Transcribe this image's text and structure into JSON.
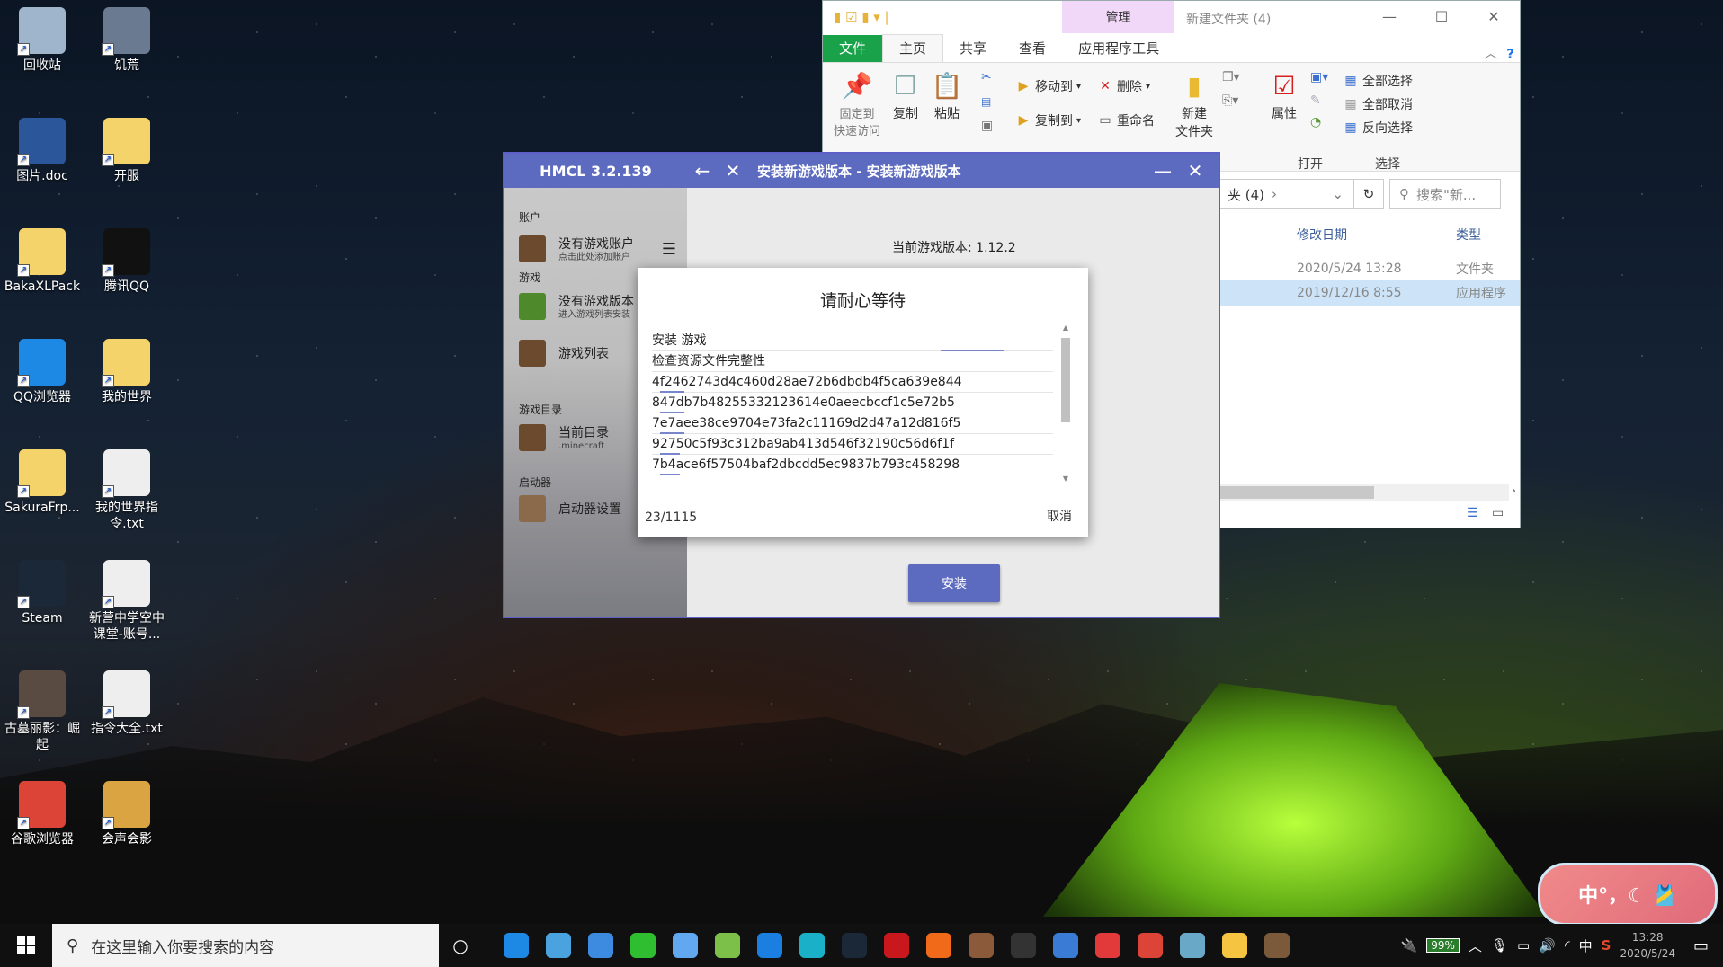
{
  "desktop": {
    "icons": [
      {
        "label": "回收站",
        "name": "recycle-bin",
        "color": "#9fb5cc"
      },
      {
        "label": "饥荒",
        "name": "dont-starve",
        "color": "#6a7a90"
      },
      {
        "label": "图片.doc",
        "name": "word-doc",
        "color": "#2b579a"
      },
      {
        "label": "开服",
        "name": "folder",
        "color": "#f5d36b"
      },
      {
        "label": "BakaXLPack",
        "name": "folder",
        "color": "#f5d36b"
      },
      {
        "label": "腾讯QQ",
        "name": "qq",
        "color": "#111111"
      },
      {
        "label": "QQ浏览器",
        "name": "qq-browser",
        "color": "#1e88e5"
      },
      {
        "label": "我的世界",
        "name": "folder",
        "color": "#f5d36b"
      },
      {
        "label": "SakuraFrp...",
        "name": "folder",
        "color": "#f5d36b"
      },
      {
        "label": "我的世界指令.txt",
        "name": "text-file",
        "color": "#eeeeee"
      },
      {
        "label": "Steam",
        "name": "steam",
        "color": "#1b2838"
      },
      {
        "label": "新营中学空中课堂-账号...",
        "name": "text-file",
        "color": "#eeeeee"
      },
      {
        "label": "古墓丽影：崛起",
        "name": "tomb-raider",
        "color": "#5a4b42"
      },
      {
        "label": "指令大全.txt",
        "name": "text-file",
        "color": "#eeeeee"
      },
      {
        "label": "谷歌浏览器",
        "name": "chrome",
        "color": "#db4437"
      },
      {
        "label": "会声会影",
        "name": "video-studio",
        "color": "#d9a441"
      }
    ]
  },
  "explorer": {
    "manage_tab": "管理",
    "window_title": "新建文件夹 (4)",
    "tabs": [
      "文件",
      "主页",
      "共享",
      "查看",
      "应用程序工具"
    ],
    "ribbon": {
      "pin": "固定到\n快速访问",
      "copy": "复制",
      "paste": "粘贴",
      "move_to": "移动到",
      "copy_to": "复制到",
      "delete": "删除",
      "rename": "重命名",
      "new_folder": "新建\n文件夹",
      "properties": "属性",
      "select_all": "全部选择",
      "select_none": "全部取消",
      "invert": "反向选择",
      "group_open": "打开",
      "group_select": "选择"
    },
    "address_tail": "夹 (4)",
    "search_placeholder": "搜索\"新...",
    "columns": {
      "modified": "修改日期",
      "type": "类型"
    },
    "rows": [
      {
        "date": "2020/5/24 13:28",
        "type": "文件夹"
      },
      {
        "date": "2019/12/16 8:55",
        "type": "应用程序"
      }
    ]
  },
  "hmcl": {
    "version": "HMCL 3.2.139",
    "title": "安装新游戏版本 - 安装新游戏版本",
    "sidebar": {
      "section_account": "账户",
      "account_name": "没有游戏账户",
      "account_sub": "点击此处添加账户",
      "section_game": "游戏",
      "no_version": "没有游戏版本",
      "no_version_sub": "进入游戏列表安装",
      "game_list": "游戏列表",
      "section_dir": "游戏目录",
      "current_dir": "当前目录",
      "current_dir_sub": ".minecraft",
      "section_launcher": "启动器",
      "launcher_settings": "启动器设置"
    },
    "current_version": "当前游戏版本: 1.12.2",
    "install_button": "安装",
    "dialog": {
      "title": "请耐心等待",
      "tasks": [
        {
          "text": "安装 游戏",
          "progress": 0.16,
          "offset": 0.72
        },
        {
          "text": "检查资源文件完整性",
          "progress": 0,
          "offset": 0
        },
        {
          "text": "4f2462743d4c460d28ae72b6dbdb4f5ca639e844",
          "progress": 0.06,
          "offset": 0.02
        },
        {
          "text": "847db7b48255332123614e0aeecbccf1c5e72b5",
          "progress": 0.06,
          "offset": 0.02
        },
        {
          "text": "7e7aee38ce9704e73fa2c11169d2d47a12d816f5",
          "progress": 0.06,
          "offset": 0.02
        },
        {
          "text": "92750c5f93c312ba9ab413d546f32190c56d6f1f",
          "progress": 0.05,
          "offset": 0.02
        },
        {
          "text": "7b4ace6f57504baf2dbcdd5ec9837b793c458298",
          "progress": 0.05,
          "offset": 0.02
        }
      ],
      "count": "23/1115",
      "cancel": "取消"
    }
  },
  "ime": {
    "text": "中°，☾ 🎽"
  },
  "taskbar": {
    "search_placeholder": "在这里输入你要搜索的内容",
    "battery": "99%",
    "lang": "中",
    "time": "13:28",
    "date": "2020/5/24",
    "apps": [
      {
        "name": "qq-browser",
        "color": "#1e88e5"
      },
      {
        "name": "chat",
        "color": "#4aa3df"
      },
      {
        "name": "feather",
        "color": "#3d8be0"
      },
      {
        "name": "iqiyi",
        "color": "#2fbe2f"
      },
      {
        "name": "pinwheel",
        "color": "#61a8f0"
      },
      {
        "name": "game-controller",
        "color": "#7cc04a"
      },
      {
        "name": "kugou",
        "color": "#1a7fe0"
      },
      {
        "name": "edge-like",
        "color": "#1ab0c8"
      },
      {
        "name": "steam",
        "color": "#1b2838"
      },
      {
        "name": "flash",
        "color": "#c8181e"
      },
      {
        "name": "firefox",
        "color": "#f06a1a"
      },
      {
        "name": "game-char",
        "color": "#8a5a3a"
      },
      {
        "name": "recorder",
        "color": "#333333"
      },
      {
        "name": "clock-app",
        "color": "#3a7bd5"
      },
      {
        "name": "netease-music",
        "color": "#e23a3a"
      },
      {
        "name": "chrome",
        "color": "#db4437"
      },
      {
        "name": "disk",
        "color": "#6aa8c8"
      },
      {
        "name": "file-explorer",
        "color": "#f5c542"
      },
      {
        "name": "minecraft",
        "color": "#7a5a3a"
      }
    ]
  }
}
